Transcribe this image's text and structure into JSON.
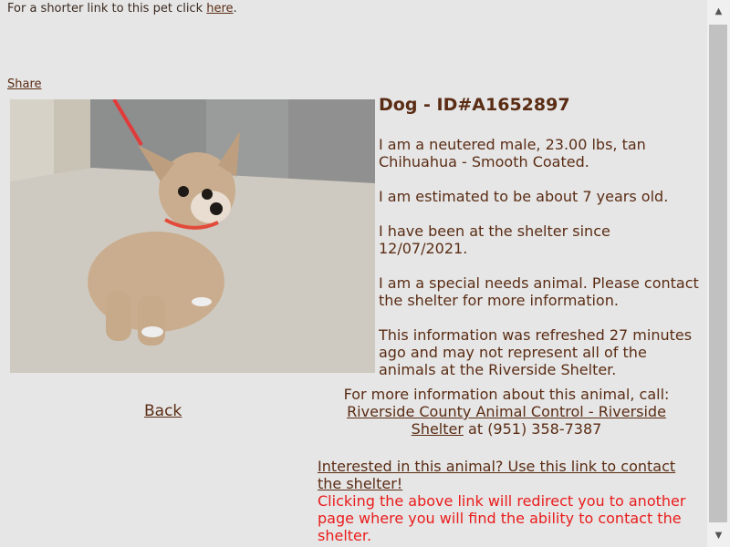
{
  "header": {
    "shorter_link_prefix": "For a shorter link to this pet click ",
    "shorter_link_text": "here",
    "shorter_link_suffix": "."
  },
  "share_label": "Share",
  "photo": {
    "alt": "Photo of a tan Chihuahua wearing a red leash"
  },
  "pet": {
    "title": "Dog - ID#A1652897",
    "description": "I am a neutered male, 23.00 lbs, tan Chihuahua - Smooth Coated.",
    "age": "I am estimated to be about 7 years old.",
    "shelter_since": "I have been at the shelter since 12/07/2021.",
    "special_needs": "I am a special needs animal. Please contact the shelter for more information.",
    "refreshed": "This information was refreshed 27 minutes ago and may not represent all of the animals at the Riverside Shelter."
  },
  "back_label": "Back",
  "contact": {
    "intro": "For more information about this animal, call:",
    "shelter_name": "Riverside County Animal Control - Riverside Shelter",
    "phone_prefix": " at ",
    "phone": "(951) 358-7387"
  },
  "interest": {
    "link_text": "Interested in this animal? Use this link to contact the shelter!",
    "redirect_notice": "Clicking the above link will redirect you to another page where you will find the ability to contact the shelter."
  },
  "scrollbar": {
    "up_icon": "▲",
    "down_icon": "▼"
  }
}
